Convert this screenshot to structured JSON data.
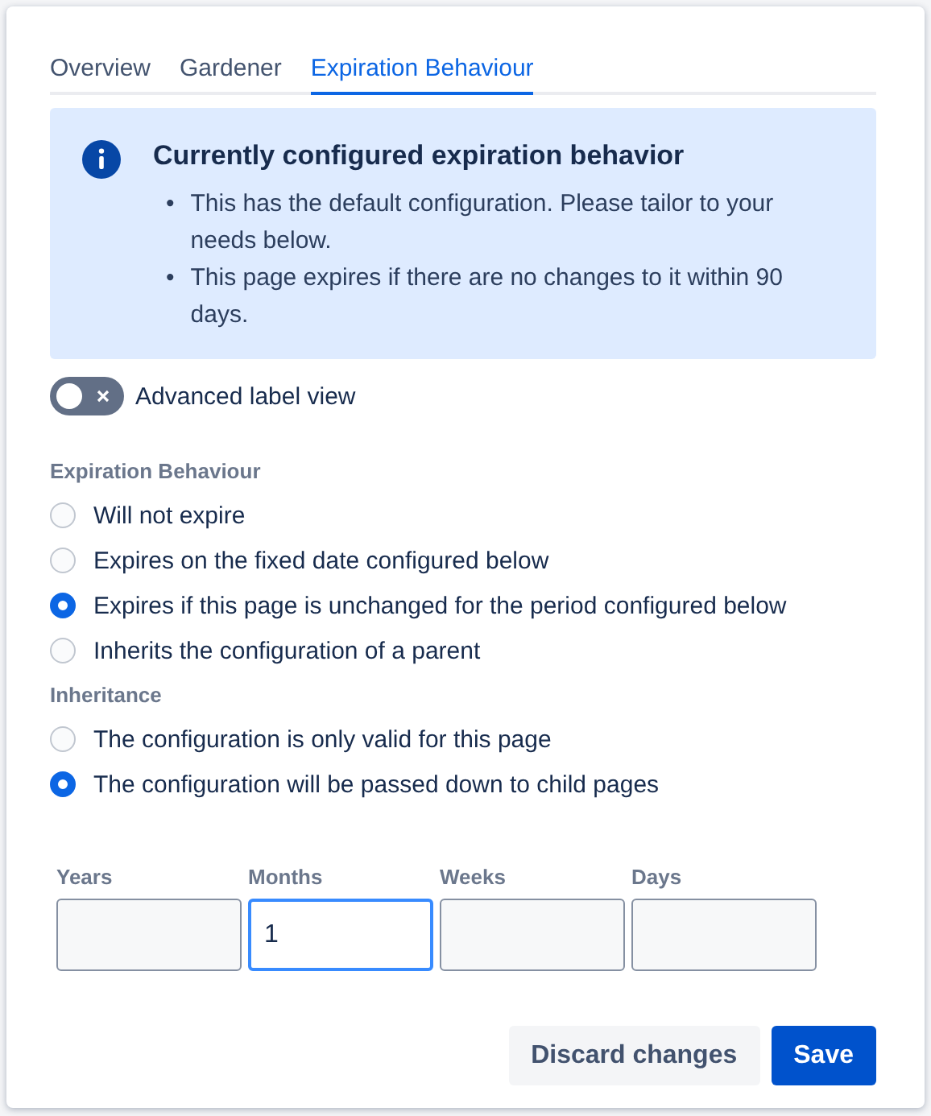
{
  "tabs": [
    {
      "label": "Overview",
      "selected": false
    },
    {
      "label": "Gardener",
      "selected": false
    },
    {
      "label": "Expiration Behaviour",
      "selected": true
    }
  ],
  "info": {
    "title": "Currently configured expiration behavior",
    "bullets": [
      {
        "marker": "•",
        "text": "This has the default configuration. Please tailor to your needs below."
      },
      {
        "marker": "•",
        "text": "This page expires if there are no changes to it within 90 days."
      }
    ]
  },
  "toggle": {
    "label": "Advanced label view",
    "on": false
  },
  "expiration": {
    "heading": "Expiration Behaviour",
    "options": [
      {
        "label": "Will not expire",
        "selected": false
      },
      {
        "label": "Expires on the fixed date configured below",
        "selected": false
      },
      {
        "label": "Expires if this page is unchanged for the period configured below",
        "selected": true
      },
      {
        "label": "Inherits the configuration of a parent",
        "selected": false
      }
    ]
  },
  "inheritance": {
    "heading": "Inheritance",
    "options": [
      {
        "label": "The configuration is only valid for this page",
        "selected": false
      },
      {
        "label": "The configuration will be passed down to child pages",
        "selected": true
      }
    ]
  },
  "period": [
    {
      "label": "Years",
      "focused": false
    },
    {
      "label": "Months",
      "value": "1",
      "focused": true
    },
    {
      "label": "Weeks",
      "focused": false
    },
    {
      "label": "Days",
      "focused": false
    }
  ],
  "buttons": [
    {
      "label": "Discard changes",
      "kind": "subtle"
    },
    {
      "label": "Save",
      "kind": "primary"
    }
  ]
}
